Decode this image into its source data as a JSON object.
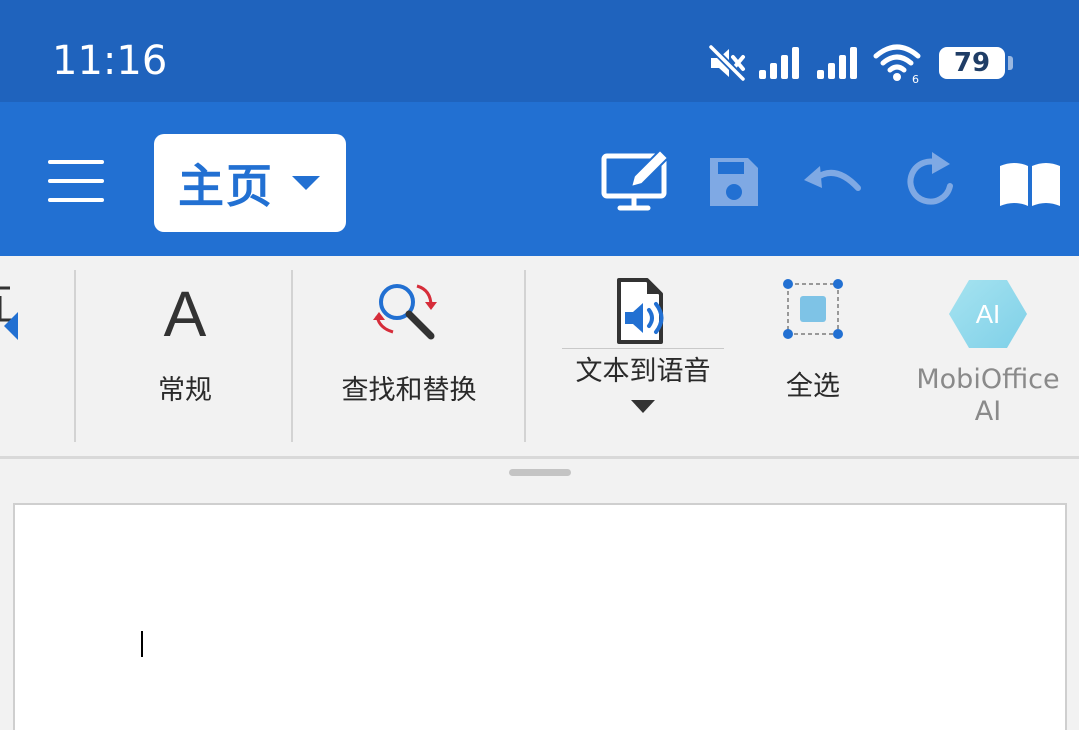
{
  "status_bar": {
    "time": "11:16",
    "battery": "79",
    "icons": [
      "mute-icon",
      "signal-icon",
      "signal-icon",
      "wifi-icon",
      "battery-icon"
    ]
  },
  "app_bar": {
    "tab_label": "主页",
    "icons": [
      "menu-icon",
      "dropdown-icon",
      "edit-mode-icon",
      "save-icon",
      "undo-icon",
      "redo-icon",
      "read-mode-icon"
    ]
  },
  "ribbon": {
    "normal_label": "常规",
    "normal_glyph": "A",
    "find_replace_label": "查找和替换",
    "tts_label": "文本到语音",
    "select_all_label": "全选",
    "ai_label_line1": "MobiOffice",
    "ai_label_line2": "AI",
    "ai_badge": "AI"
  },
  "colors": {
    "status_bar": "#1f63bd",
    "app_bar": "#2270d2",
    "ribbon_bg": "#f2f2f2",
    "accent": "#2270d2"
  }
}
